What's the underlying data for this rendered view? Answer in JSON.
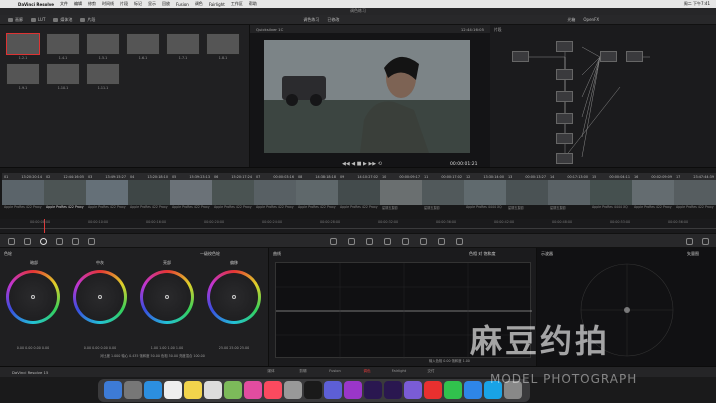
{
  "menubar": {
    "app": "DaVinci Resolve",
    "items": [
      "文件",
      "编辑",
      "修剪",
      "时间线",
      "片段",
      "标记",
      "显示",
      "回放",
      "Fusion",
      "调色",
      "Fairlight",
      "工作区",
      "帮助"
    ],
    "clock": "周二 下午7:41"
  },
  "window_title": "调色练习",
  "toolbar": {
    "gallery": "画廊",
    "lut": "LUT",
    "media": "媒体池",
    "clips": "片段",
    "timeline_ver": "Quicksilver 1C",
    "viewer_title": "调色练习",
    "mod": "已修改",
    "tc": "12:44:16:05",
    "node_label": "片段",
    "effects": "OpenFX",
    "lightbox": "光箱"
  },
  "stills": [
    {
      "label": "1.2.1"
    },
    {
      "label": "1.4.1"
    },
    {
      "label": "1.5.1"
    },
    {
      "label": "1.6.1"
    },
    {
      "label": "1.7.1"
    },
    {
      "label": "1.8.1"
    },
    {
      "label": "1.9.1"
    },
    {
      "label": "1.10.1"
    },
    {
      "label": "1.11.1"
    }
  ],
  "viewer": {
    "timecode": "00:00:01:21"
  },
  "clips": [
    {
      "n": "01",
      "tc": "13:20:20:14",
      "codec": "Apple ProRes 422 Proxy",
      "sel": false
    },
    {
      "n": "02",
      "tc": "12:44:16:05",
      "codec": "Apple ProRes 422 Proxy",
      "sel": true
    },
    {
      "n": "03",
      "tc": "13:49:15:27",
      "codec": "Apple ProRes 422 Proxy",
      "sel": false
    },
    {
      "n": "04",
      "tc": "13:20:18:10",
      "codec": "Apple ProRes 422 Proxy",
      "sel": false
    },
    {
      "n": "05",
      "tc": "15:39:23:13",
      "codec": "Apple ProRes 422 Proxy",
      "sel": false
    },
    {
      "n": "06",
      "tc": "15:20:17:24",
      "codec": "Apple ProRes 422 Proxy",
      "sel": false
    },
    {
      "n": "07",
      "tc": "00:00:03:16",
      "codec": "Apple ProRes 422 Proxy",
      "sel": false
    },
    {
      "n": "08",
      "tc": "14:38:18:18",
      "codec": "Apple ProRes 422 Proxy",
      "sel": false
    },
    {
      "n": "09",
      "tc": "14:10:27:02",
      "codec": "Apple ProRes 422 Proxy",
      "sel": false
    },
    {
      "n": "10",
      "tc": "00:00:09:17",
      "codec": "星期五摄影",
      "sel": false
    },
    {
      "n": "11",
      "tc": "00:00:17:02",
      "codec": "星期五摄影",
      "sel": false
    },
    {
      "n": "12",
      "tc": "13:30:14:00",
      "codec": "Apple ProRes 4444 XQ",
      "sel": false
    },
    {
      "n": "13",
      "tc": "00:00:13:27",
      "codec": "星期五摄影",
      "sel": false
    },
    {
      "n": "14",
      "tc": "00:17:13:00",
      "codec": "星期五摄影",
      "sel": false
    },
    {
      "n": "15",
      "tc": "00:00:04:11",
      "codec": "Apple ProRes 4444 XQ",
      "sel": false
    },
    {
      "n": "16",
      "tc": "00:02:09:09",
      "codec": "Apple ProRes 422 Proxy",
      "sel": false
    },
    {
      "n": "17",
      "tc": "23:47:44:39",
      "codec": "Apple ProRes 422 Proxy",
      "sel": false
    }
  ],
  "ruler": [
    "00:00:08:00",
    "00:00:10:00",
    "00:00:16:00",
    "00:00:20:00",
    "00:00:24:00",
    "00:00:28:00",
    "00:00:32:00",
    "00:00:36:00",
    "00:00:42:00",
    "00:00:48:00",
    "00:00:53:00",
    "00:00:56:00"
  ],
  "wheels": {
    "title": "色轮",
    "mode": "一级校色轮",
    "items": [
      {
        "name": "暗部",
        "vals": "0.00  0.00  0.00  0.00"
      },
      {
        "name": "中灰",
        "vals": "0.00  0.00  0.00  0.00"
      },
      {
        "name": "亮部",
        "vals": "1.00  1.00  1.00  1.00"
      },
      {
        "name": "偏移",
        "vals": "25.00  25.00  25.00"
      }
    ],
    "params": "对比度 1.000   轴心 0.435   饱和度 50.00   色相 50.00   亮度混合 100.00"
  },
  "curves": {
    "title": "曲线",
    "mode": "色相 对 饱和度",
    "footer": "输入色相 0.00   饱和度 1.00"
  },
  "scopes": {
    "title": "示波器",
    "mode": "矢量图"
  },
  "pages": [
    "媒体",
    "剪辑",
    "Fusion",
    "调色",
    "Fairlight",
    "交付"
  ],
  "active_page": "调色",
  "footer_brand": "DaVinci Resolve 15",
  "watermark": {
    "brand": "麻豆约拍",
    "sub": "MODEL PHOTOGRAPH"
  },
  "colors": {
    "accent": "#e03a3a",
    "wheel_ring": "conic-rgb"
  }
}
